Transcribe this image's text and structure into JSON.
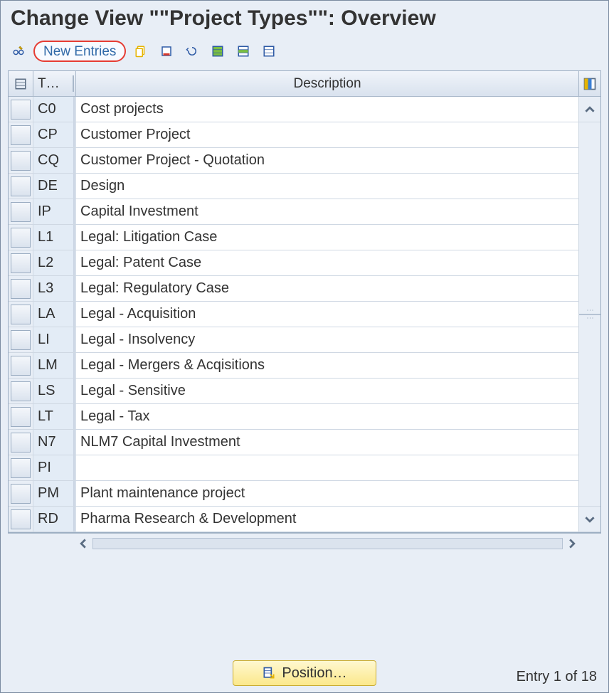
{
  "title": "Change View \"\"Project Types\"\": Overview",
  "toolbar": {
    "toggle_label": "Display <-> Change",
    "new_entries": "New Entries",
    "copy_label": "Copy As...",
    "delete_label": "Delete",
    "undo_label": "Undo Change",
    "select_all_label": "Select All",
    "select_block_label": "Select Block",
    "deselect_all_label": "Deselect All"
  },
  "columns": {
    "key_header": "T…",
    "desc_header": "Description"
  },
  "rows": [
    {
      "key": "C0",
      "desc": "Cost projects"
    },
    {
      "key": "CP",
      "desc": "Customer Project"
    },
    {
      "key": "CQ",
      "desc": "Customer Project - Quotation"
    },
    {
      "key": "DE",
      "desc": "Design"
    },
    {
      "key": "IP",
      "desc": "Capital Investment"
    },
    {
      "key": "L1",
      "desc": "Legal: Litigation Case"
    },
    {
      "key": "L2",
      "desc": "Legal: Patent Case"
    },
    {
      "key": "L3",
      "desc": "Legal: Regulatory Case"
    },
    {
      "key": "LA",
      "desc": "Legal - Acquisition"
    },
    {
      "key": "LI",
      "desc": "Legal - Insolvency"
    },
    {
      "key": "LM",
      "desc": "Legal - Mergers & Acqisitions"
    },
    {
      "key": "LS",
      "desc": "Legal - Sensitive"
    },
    {
      "key": "LT",
      "desc": "Legal - Tax"
    },
    {
      "key": "N7",
      "desc": "NLM7 Capital Investment"
    },
    {
      "key": "PI",
      "desc": ""
    },
    {
      "key": "PM",
      "desc": "Plant maintenance project"
    },
    {
      "key": "RD",
      "desc": "Pharma Research & Development"
    }
  ],
  "footer": {
    "position_btn": "Position…",
    "entry_info": "Entry 1 of 18"
  }
}
